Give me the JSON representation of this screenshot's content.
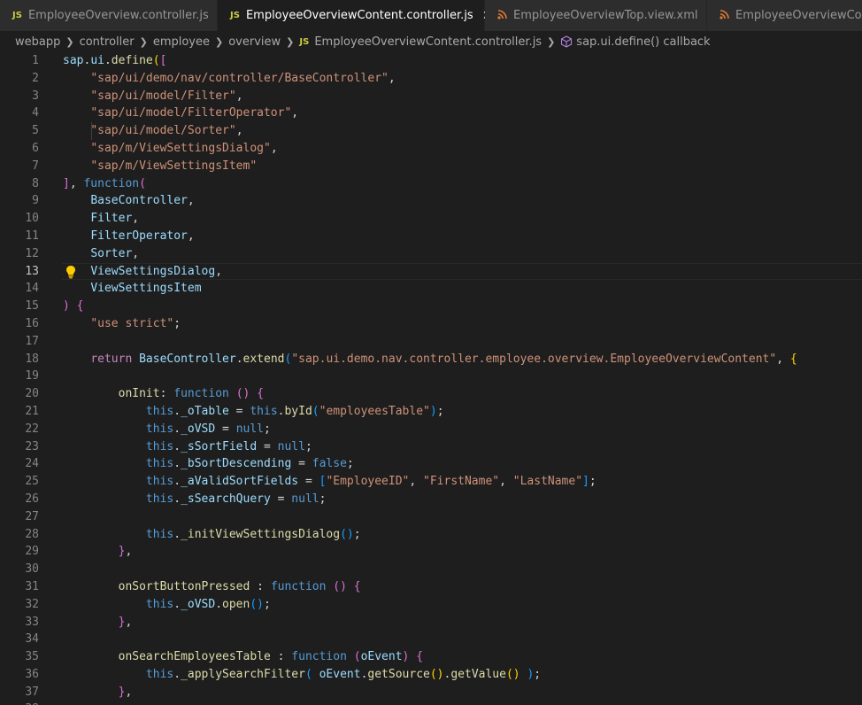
{
  "tabs": [
    {
      "label": "EmployeeOverview.controller.js",
      "icon": "js-icon",
      "icon_text": "JS",
      "active": false
    },
    {
      "label": "EmployeeOverviewContent.controller.js",
      "icon": "js-icon",
      "icon_text": "JS",
      "active": true,
      "close": "✕"
    },
    {
      "label": "EmployeeOverviewTop.view.xml",
      "icon": "rss-icon",
      "active": false
    },
    {
      "label": "EmployeeOverviewCont",
      "icon": "rss-icon",
      "active": false
    }
  ],
  "breadcrumb": {
    "items": [
      "webapp",
      "controller",
      "employee",
      "overview"
    ],
    "file": "EmployeeOverviewContent.controller.js",
    "file_icon": "JS",
    "symbol": "sap.ui.define() callback"
  },
  "editor": {
    "current_line": 13,
    "lines": [
      {
        "n": "1",
        "t": [
          [
            "sap",
            "v"
          ],
          [
            ".",
            "p"
          ],
          [
            "ui",
            "v"
          ],
          [
            ".",
            "p"
          ],
          [
            "define",
            "f"
          ],
          [
            "(",
            "b3"
          ],
          [
            "[",
            "b1"
          ]
        ]
      },
      {
        "n": "2",
        "t": [
          [
            "    ",
            "p"
          ],
          [
            "\"sap/ui/demo/nav/controller/BaseController\"",
            "s"
          ],
          [
            ",",
            "p"
          ]
        ]
      },
      {
        "n": "3",
        "t": [
          [
            "    ",
            "p"
          ],
          [
            "\"sap/ui/model/Filter\"",
            "s"
          ],
          [
            ",",
            "p"
          ]
        ]
      },
      {
        "n": "4",
        "t": [
          [
            "    ",
            "p"
          ],
          [
            "\"sap/ui/model/FilterOperator\"",
            "s"
          ],
          [
            ",",
            "p"
          ]
        ]
      },
      {
        "n": "5",
        "t": [
          [
            "    ",
            "p"
          ],
          [
            "\"sap/ui/model/Sorter\"",
            "s"
          ],
          [
            ",",
            "p"
          ]
        ]
      },
      {
        "n": "6",
        "t": [
          [
            "    ",
            "p"
          ],
          [
            "\"sap/m/ViewSettingsDialog\"",
            "s"
          ],
          [
            ",",
            "p"
          ]
        ]
      },
      {
        "n": "7",
        "t": [
          [
            "    ",
            "p"
          ],
          [
            "\"sap/m/ViewSettingsItem\"",
            "s"
          ]
        ]
      },
      {
        "n": "8",
        "t": [
          [
            "]",
            "b1"
          ],
          [
            ", ",
            "p"
          ],
          [
            "function",
            "k"
          ],
          [
            "(",
            "b1"
          ]
        ]
      },
      {
        "n": "9",
        "t": [
          [
            "    ",
            "p"
          ],
          [
            "BaseController",
            "v"
          ],
          [
            ",",
            "p"
          ]
        ]
      },
      {
        "n": "10",
        "t": [
          [
            "    ",
            "p"
          ],
          [
            "Filter",
            "v"
          ],
          [
            ",",
            "p"
          ]
        ]
      },
      {
        "n": "11",
        "t": [
          [
            "    ",
            "p"
          ],
          [
            "FilterOperator",
            "v"
          ],
          [
            ",",
            "p"
          ]
        ]
      },
      {
        "n": "12",
        "t": [
          [
            "    ",
            "p"
          ],
          [
            "Sorter",
            "v"
          ],
          [
            ",",
            "p"
          ]
        ]
      },
      {
        "n": "13",
        "t": [
          [
            "    ",
            "p"
          ],
          [
            "ViewSettingsDialog",
            "v"
          ],
          [
            ",",
            "p"
          ]
        ]
      },
      {
        "n": "14",
        "t": [
          [
            "    ",
            "p"
          ],
          [
            "ViewSettingsItem",
            "v"
          ]
        ]
      },
      {
        "n": "15",
        "t": [
          [
            ")",
            "b1"
          ],
          [
            " ",
            "p"
          ],
          [
            "{",
            "b1"
          ]
        ]
      },
      {
        "n": "16",
        "t": [
          [
            "    ",
            "p"
          ],
          [
            "\"use strict\"",
            "s"
          ],
          [
            ";",
            "p"
          ]
        ]
      },
      {
        "n": "17",
        "t": []
      },
      {
        "n": "18",
        "t": [
          [
            "    ",
            "p"
          ],
          [
            "return",
            "c"
          ],
          [
            " ",
            "p"
          ],
          [
            "BaseController",
            "v"
          ],
          [
            ".",
            "p"
          ],
          [
            "extend",
            "f"
          ],
          [
            "(",
            "b2"
          ],
          [
            "\"sap.ui.demo.nav.controller.employee.overview.EmployeeOverviewContent\"",
            "s"
          ],
          [
            ", ",
            "p"
          ],
          [
            "{",
            "b3"
          ]
        ]
      },
      {
        "n": "19",
        "t": []
      },
      {
        "n": "20",
        "t": [
          [
            "        ",
            "p"
          ],
          [
            "onInit",
            "f"
          ],
          [
            ": ",
            "p"
          ],
          [
            "function",
            "k"
          ],
          [
            " ",
            "p"
          ],
          [
            "()",
            "b1"
          ],
          [
            " ",
            "p"
          ],
          [
            "{",
            "b1"
          ]
        ]
      },
      {
        "n": "21",
        "t": [
          [
            "            ",
            "p"
          ],
          [
            "this",
            "k"
          ],
          [
            ".",
            "p"
          ],
          [
            "_oTable",
            "v"
          ],
          [
            " = ",
            "p"
          ],
          [
            "this",
            "k"
          ],
          [
            ".",
            "p"
          ],
          [
            "byId",
            "f"
          ],
          [
            "(",
            "b2"
          ],
          [
            "\"employeesTable\"",
            "s"
          ],
          [
            ")",
            "b2"
          ],
          [
            ";",
            "p"
          ]
        ]
      },
      {
        "n": "22",
        "t": [
          [
            "            ",
            "p"
          ],
          [
            "this",
            "k"
          ],
          [
            ".",
            "p"
          ],
          [
            "_oVSD",
            "v"
          ],
          [
            " = ",
            "p"
          ],
          [
            "null",
            "k"
          ],
          [
            ";",
            "p"
          ]
        ]
      },
      {
        "n": "23",
        "t": [
          [
            "            ",
            "p"
          ],
          [
            "this",
            "k"
          ],
          [
            ".",
            "p"
          ],
          [
            "_sSortField",
            "v"
          ],
          [
            " = ",
            "p"
          ],
          [
            "null",
            "k"
          ],
          [
            ";",
            "p"
          ]
        ]
      },
      {
        "n": "24",
        "t": [
          [
            "            ",
            "p"
          ],
          [
            "this",
            "k"
          ],
          [
            ".",
            "p"
          ],
          [
            "_bSortDescending",
            "v"
          ],
          [
            " = ",
            "p"
          ],
          [
            "false",
            "k"
          ],
          [
            ";",
            "p"
          ]
        ]
      },
      {
        "n": "25",
        "t": [
          [
            "            ",
            "p"
          ],
          [
            "this",
            "k"
          ],
          [
            ".",
            "p"
          ],
          [
            "_aValidSortFields",
            "v"
          ],
          [
            " = ",
            "p"
          ],
          [
            "[",
            "b2"
          ],
          [
            "\"EmployeeID\"",
            "s"
          ],
          [
            ", ",
            "p"
          ],
          [
            "\"FirstName\"",
            "s"
          ],
          [
            ", ",
            "p"
          ],
          [
            "\"LastName\"",
            "s"
          ],
          [
            "]",
            "b2"
          ],
          [
            ";",
            "p"
          ]
        ]
      },
      {
        "n": "26",
        "t": [
          [
            "            ",
            "p"
          ],
          [
            "this",
            "k"
          ],
          [
            ".",
            "p"
          ],
          [
            "_sSearchQuery",
            "v"
          ],
          [
            " = ",
            "p"
          ],
          [
            "null",
            "k"
          ],
          [
            ";",
            "p"
          ]
        ]
      },
      {
        "n": "27",
        "t": []
      },
      {
        "n": "28",
        "t": [
          [
            "            ",
            "p"
          ],
          [
            "this",
            "k"
          ],
          [
            ".",
            "p"
          ],
          [
            "_initViewSettingsDialog",
            "f"
          ],
          [
            "()",
            "b2"
          ],
          [
            ";",
            "p"
          ]
        ]
      },
      {
        "n": "29",
        "t": [
          [
            "        ",
            "p"
          ],
          [
            "}",
            "b1"
          ],
          [
            ",",
            "p"
          ]
        ]
      },
      {
        "n": "30",
        "t": []
      },
      {
        "n": "31",
        "t": [
          [
            "        ",
            "p"
          ],
          [
            "onSortButtonPressed",
            "f"
          ],
          [
            " : ",
            "p"
          ],
          [
            "function",
            "k"
          ],
          [
            " ",
            "p"
          ],
          [
            "()",
            "b1"
          ],
          [
            " ",
            "p"
          ],
          [
            "{",
            "b1"
          ]
        ]
      },
      {
        "n": "32",
        "t": [
          [
            "            ",
            "p"
          ],
          [
            "this",
            "k"
          ],
          [
            ".",
            "p"
          ],
          [
            "_oVSD",
            "v"
          ],
          [
            ".",
            "p"
          ],
          [
            "open",
            "f"
          ],
          [
            "()",
            "b2"
          ],
          [
            ";",
            "p"
          ]
        ]
      },
      {
        "n": "33",
        "t": [
          [
            "        ",
            "p"
          ],
          [
            "}",
            "b1"
          ],
          [
            ",",
            "p"
          ]
        ]
      },
      {
        "n": "34",
        "t": []
      },
      {
        "n": "35",
        "t": [
          [
            "        ",
            "p"
          ],
          [
            "onSearchEmployeesTable",
            "f"
          ],
          [
            " : ",
            "p"
          ],
          [
            "function",
            "k"
          ],
          [
            " ",
            "p"
          ],
          [
            "(",
            "b1"
          ],
          [
            "oEvent",
            "v"
          ],
          [
            ")",
            "b1"
          ],
          [
            " ",
            "p"
          ],
          [
            "{",
            "b1"
          ]
        ]
      },
      {
        "n": "36",
        "t": [
          [
            "            ",
            "p"
          ],
          [
            "this",
            "k"
          ],
          [
            ".",
            "p"
          ],
          [
            "_applySearchFilter",
            "f"
          ],
          [
            "(",
            "b2"
          ],
          [
            " ",
            "p"
          ],
          [
            "oEvent",
            "v"
          ],
          [
            ".",
            "p"
          ],
          [
            "getSource",
            "f"
          ],
          [
            "()",
            "b3"
          ],
          [
            ".",
            "p"
          ],
          [
            "getValue",
            "f"
          ],
          [
            "()",
            "b3"
          ],
          [
            " ",
            "p"
          ],
          [
            ")",
            "b2"
          ],
          [
            ";",
            "p"
          ]
        ]
      },
      {
        "n": "37",
        "t": [
          [
            "        ",
            "p"
          ],
          [
            "}",
            "b1"
          ],
          [
            ",",
            "p"
          ]
        ]
      },
      {
        "n": "38",
        "t": []
      }
    ]
  }
}
